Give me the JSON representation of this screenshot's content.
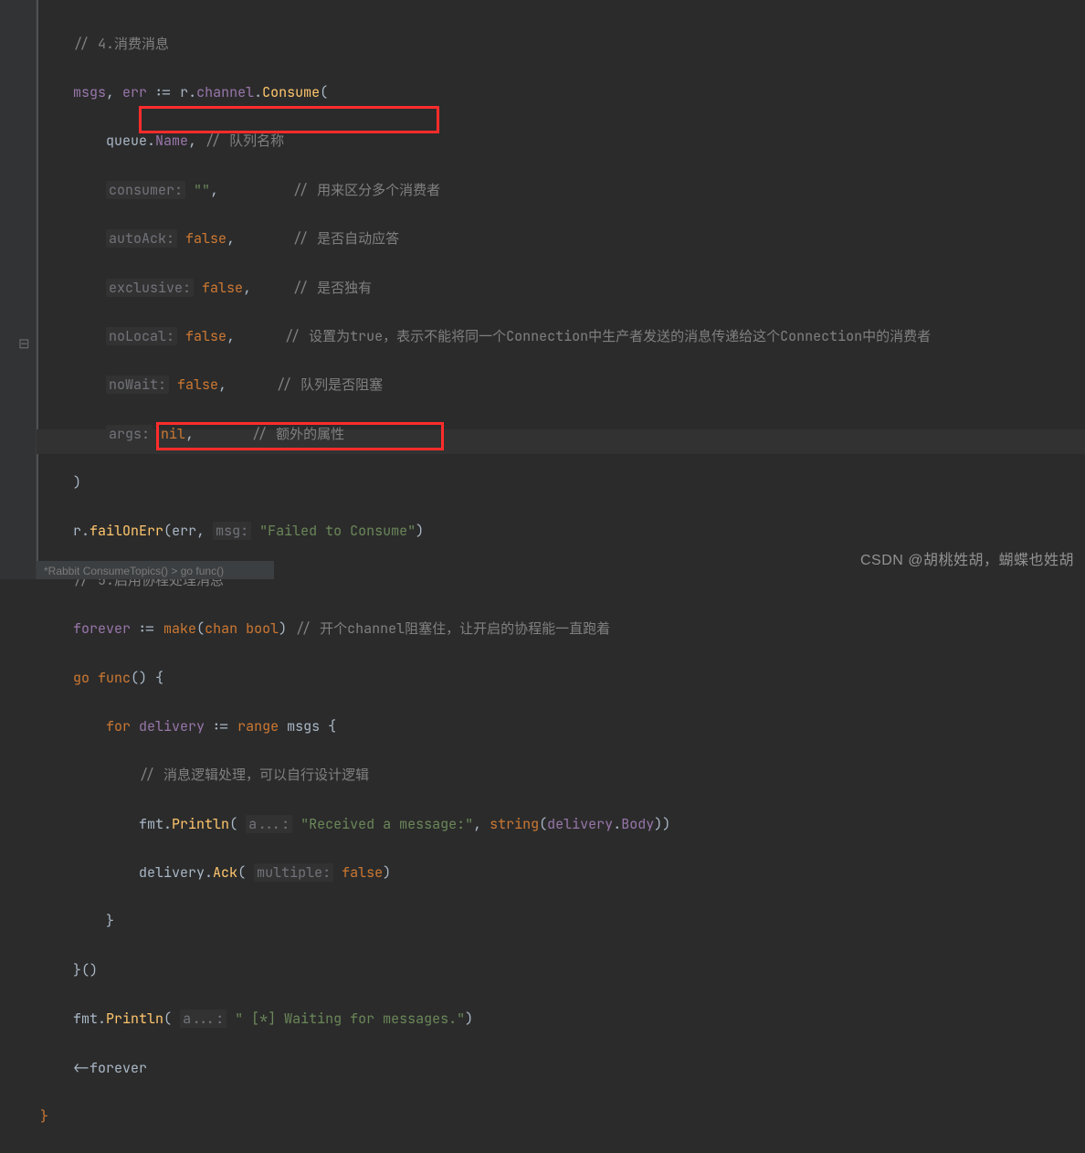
{
  "code": {
    "c0": "// 4.消费消息",
    "l1a": "msgs",
    "l1b": "err",
    "l1c": "r",
    "l1d": "channel",
    "l1e": "Consume",
    "l2a": "queue",
    "l2b": "Name",
    "c2": "// 队列名称",
    "p3": "consumer:",
    "s3": "\"\"",
    "c3": "// 用来区分多个消费者",
    "p4": "autoAck:",
    "k4": "false",
    "c4": "// 是否自动应答",
    "p5": "exclusive:",
    "k5": "false",
    "c5": "// 是否独有",
    "p6": "noLocal:",
    "k6": "false",
    "c6": "// 设置为true，表示不能将同一个Connection中生产者发送的消息传递给这个Connection中的消费者",
    "p7": "noWait:",
    "k7": "false",
    "c7": "// 队列是否阻塞",
    "p8": "args:",
    "k8": "nil",
    "c8": "// 额外的属性",
    "l9": ")",
    "l10a": "r",
    "l10b": "failOnErr",
    "l10c": "err",
    "p10": "msg:",
    "s10": "\"Failed to Consume\"",
    "c11": "// 5.启用协程处理消息",
    "l12a": "forever",
    "l12b": "make",
    "l12c": "chan",
    "l12d": "bool",
    "c12": "// 开个channel阻塞住，让开启的协程能一直跑着",
    "l13a": "go",
    "l13b": "func",
    "l14a": "for",
    "l14b": "delivery",
    "l14c": "range",
    "l14d": "msgs",
    "c15": "// 消息逻辑处理，可以自行设计逻辑",
    "l16a": "fmt",
    "l16b": "Println",
    "p16": "a...:",
    "s16": "\"Received a message:\"",
    "l16c": "string",
    "l16d": "delivery",
    "l16e": "Body",
    "l17a": "delivery",
    "l17b": "Ack",
    "p17": "multiple:",
    "k17": "false",
    "l18": "}",
    "l19": "}()",
    "l20a": "fmt",
    "l20b": "Println",
    "p20": "a...:",
    "s20": "\" [*] Waiting for messages.\"",
    "l21": "<-forever",
    "l22": "}"
  },
  "watermark": "CSDN @胡桃姓胡，蝴蝶也姓胡",
  "crumbs": "*Rabbit  ConsumeTopics()  >  go func()"
}
